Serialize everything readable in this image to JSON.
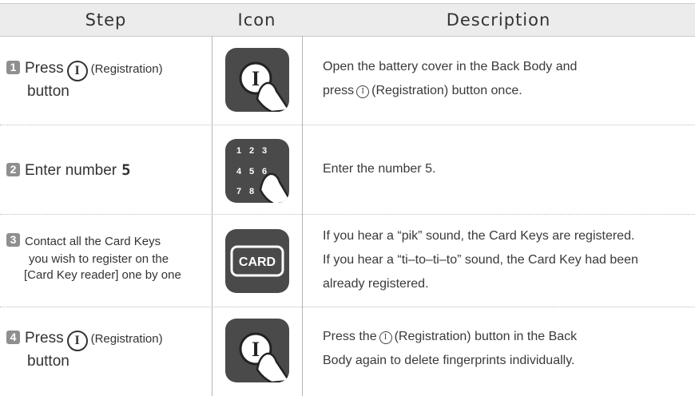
{
  "header": {
    "step": "Step",
    "icon": "Icon",
    "description": "Description"
  },
  "rows": [
    {
      "num": "1",
      "step_pre": "Press",
      "reg_symbol": "I",
      "step_post": "(Registration)",
      "step_line2": "button",
      "icon": "registration-button-icon",
      "desc_line1": "Open the battery cover in the Back Body and",
      "desc_line2_pre": "press",
      "desc_reg_symbol": "I",
      "desc_line2_post": "(Registration) button once."
    },
    {
      "num": "2",
      "step_text": "Enter number",
      "step_number": "5",
      "icon": "keypad-icon",
      "keypad_digits": [
        "1",
        "2",
        "3",
        "4",
        "5",
        "6",
        "7",
        "8"
      ],
      "desc_line1": "Enter the number 5."
    },
    {
      "num": "3",
      "step_line1": "Contact all the Card Keys",
      "step_line2": "you wish to register on the",
      "step_line3": "[Card Key reader] one by one",
      "icon": "card-icon",
      "icon_label": "CARD",
      "desc_line1": "If you hear a “pik” sound, the Card Keys are registered.",
      "desc_line2": "If you hear a “ti–to–ti–to” sound, the Card Key had been",
      "desc_line3": "already registered."
    },
    {
      "num": "4",
      "step_pre": "Press",
      "reg_symbol": "I",
      "step_post": "(Registration)",
      "step_line2": "button",
      "icon": "registration-button-icon",
      "desc_line1_pre": "Press the",
      "desc_reg_symbol": "I",
      "desc_line1_post": "(Registration) button in the Back",
      "desc_line2": "Body again to delete fingerprints individually."
    }
  ],
  "colors": {
    "header_bg": "#ececec",
    "icon_bg": "#4a4a4a",
    "badge_bg": "#8f8f8f",
    "text": "#333333"
  }
}
